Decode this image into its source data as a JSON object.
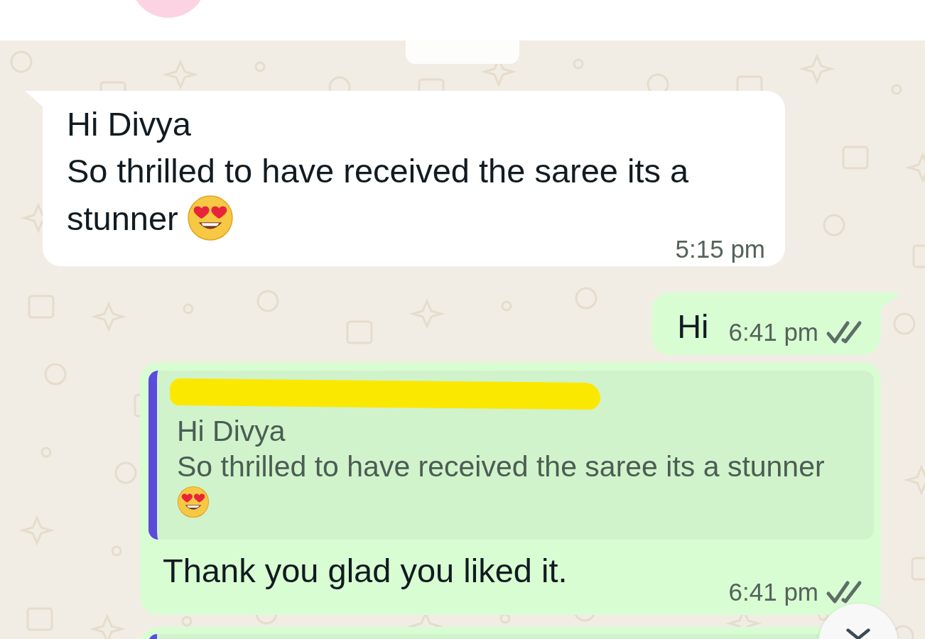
{
  "messages": [
    {
      "incoming": true,
      "text": "Hi Divya\nSo thrilled to have received the saree its a stunner",
      "emoji": true,
      "time": "5:15 pm"
    },
    {
      "incoming": false,
      "text": "Hi",
      "time": "6:41 pm",
      "read": false
    },
    {
      "incoming": false,
      "reply": {
        "sender_redacted": true,
        "text": "Hi Divya\nSo thrilled to have received the saree its a stunner",
        "emoji": true
      },
      "text": "Thank you glad you liked it.",
      "time": "6:41 pm",
      "read": false
    },
    {
      "incoming": false,
      "cut_off": true
    }
  ]
}
